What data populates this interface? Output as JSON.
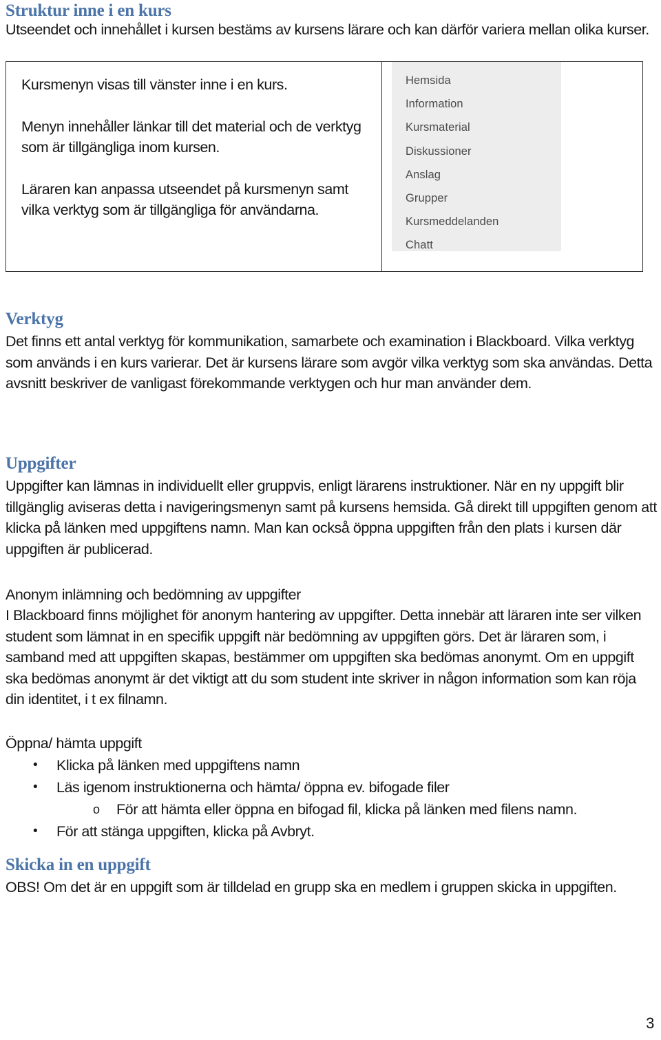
{
  "document": {
    "title_heading": "Struktur inne i en kurs",
    "intro_paragraph": "Utseendet och innehållet i kursen bestäms av kursens lärare och kan därför variera mellan olika kurser.",
    "page_number": "3"
  },
  "course_box": {
    "paragraphs": [
      "Kursmenyn visas till vänster inne i en kurs.",
      "Menyn innehåller länkar till det material och de verktyg som är tillgängliga inom kursen.",
      "Läraren kan anpassa utseendet på kursmenyn samt vilka verktyg som är tillgängliga för användarna."
    ],
    "menu_items": [
      "Hemsida",
      "Information",
      "Kursmaterial",
      "Diskussioner",
      "Anslag",
      "Grupper",
      "Kursmeddelanden",
      "Chatt"
    ],
    "panel_background": "#ededed",
    "border_color": "#2b2b2b"
  },
  "sections": {
    "verktyg": {
      "heading": "Verktyg",
      "body": "Det finns ett antal verktyg för kommunikation, samarbete och examination i Blackboard. Vilka verktyg som används i en kurs varierar. Det är kursens lärare som avgör vilka verktyg som ska användas. Detta avsnitt beskriver de vanligast förekommande verktygen och hur man använder dem."
    },
    "uppgifter": {
      "heading": "Uppgifter",
      "body": "Uppgifter kan lämnas in individuellt eller gruppvis, enligt lärarens instruktioner. När en ny uppgift blir tillgänglig aviseras detta i navigeringsmenyn samt på kursens hemsida. Gå direkt till uppgiften genom att klicka på länken med uppgiftens namn. Man kan också öppna uppgiften från den plats i kursen där uppgiften är publicerad."
    },
    "anonym": {
      "heading": "Anonym inlämning och bedömning av uppgifter",
      "body": "I Blackboard finns möjlighet för anonym hantering av uppgifter. Detta innebär att läraren inte ser vilken student som lämnat in en specifik uppgift när bedömning av uppgiften görs. Det är läraren som, i samband med att uppgiften skapas, bestämmer om uppgiften ska bedömas anonymt. Om en uppgift ska bedömas anonymt är det viktigt att du som student inte skriver in någon information som kan röja din identitet, i t ex filnamn."
    },
    "oppna": {
      "heading": "Öppna/ hämta uppgift",
      "bullets": [
        {
          "marker": "•",
          "level": 1,
          "text": "Klicka på länken med uppgiftens namn"
        },
        {
          "marker": "•",
          "level": 1,
          "text": "Läs igenom instruktionerna och hämta/ öppna ev. bifogade filer"
        },
        {
          "marker": "o",
          "level": 2,
          "text": "För att hämta eller öppna en bifogad fil, klicka på länken med filens namn."
        },
        {
          "marker": "•",
          "level": 1,
          "text": "För att stänga uppgiften, klicka på Avbryt."
        }
      ]
    },
    "skicka": {
      "heading": "Skicka in en uppgift",
      "body": "OBS! Om det är en uppgift som är tilldelad en grupp ska en medlem i gruppen skicka in uppgiften."
    }
  },
  "colors": {
    "heading_blue": "#4B74A8",
    "body_text": "#161616",
    "menu_text": "#4a4a4a"
  }
}
